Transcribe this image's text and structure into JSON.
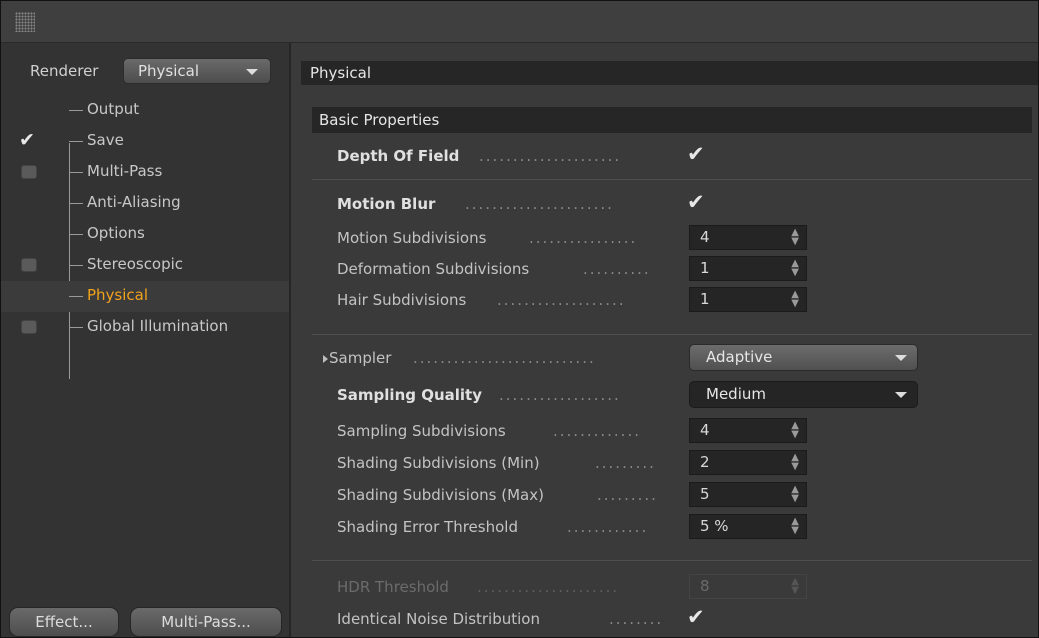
{
  "left_panel": {
    "renderer_label": "Renderer",
    "renderer_value": "Physical",
    "tree": [
      {
        "label": "Output",
        "checkbox": "none"
      },
      {
        "label": "Save",
        "checkbox": "checked"
      },
      {
        "label": "Multi-Pass",
        "checkbox": "unchecked"
      },
      {
        "label": "Anti-Aliasing",
        "checkbox": "none"
      },
      {
        "label": "Options",
        "checkbox": "none"
      },
      {
        "label": "Stereoscopic",
        "checkbox": "unchecked"
      },
      {
        "label": "Physical",
        "checkbox": "none",
        "active": true
      },
      {
        "label": "Global Illumination",
        "checkbox": "unchecked"
      }
    ],
    "effect_button": "Effect...",
    "multipass_button": "Multi-Pass..."
  },
  "right_panel": {
    "header": "Physical",
    "section": "Basic Properties",
    "check_symbol": "✔",
    "rows": {
      "depth_of_field": {
        "label": "Depth Of Field",
        "checked": true
      },
      "motion_blur": {
        "label": "Motion Blur",
        "checked": true
      },
      "motion_subdivisions": {
        "label": "Motion Subdivisions",
        "value": "4"
      },
      "deformation_subdivisions": {
        "label": "Deformation Subdivisions",
        "value": "1"
      },
      "hair_subdivisions": {
        "label": "Hair Subdivisions",
        "value": "1"
      },
      "sampler": {
        "label": "Sampler",
        "value": "Adaptive"
      },
      "sampling_quality": {
        "label": "Sampling Quality",
        "value": "Medium"
      },
      "sampling_subdivisions": {
        "label": "Sampling Subdivisions",
        "value": "4"
      },
      "shading_subdivisions_min": {
        "label": "Shading Subdivisions (Min)",
        "value": "2"
      },
      "shading_subdivisions_max": {
        "label": "Shading Subdivisions (Max)",
        "value": "5"
      },
      "shading_error_threshold": {
        "label": "Shading Error Threshold",
        "value": "5 %"
      },
      "hdr_threshold": {
        "label": "HDR Threshold",
        "value": "8",
        "disabled": true
      },
      "identical_noise_distribution": {
        "label": "Identical Noise Distribution",
        "checked": true
      }
    }
  },
  "icons": {
    "grip": "grip-icon",
    "dropdown": "dropdown-arrow-icon",
    "spinner": "spinner-arrows-icon",
    "expand": "expand-triangle-icon"
  }
}
